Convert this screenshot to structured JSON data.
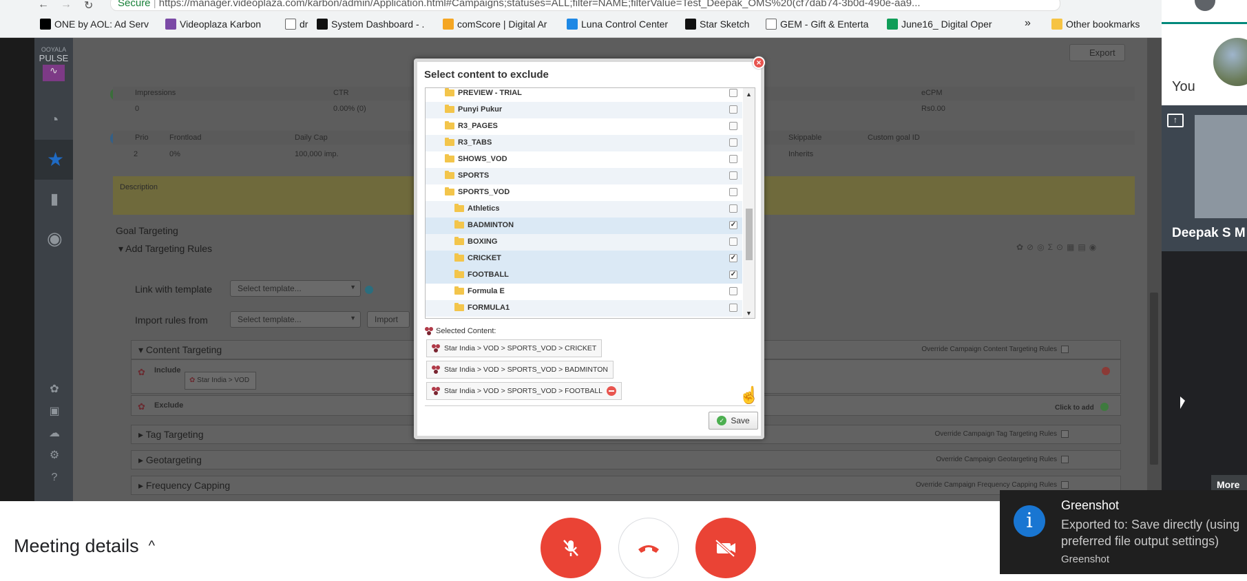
{
  "browser": {
    "secure_label": "Secure",
    "url": "https://manager.videoplaza.com/karbon/admin/Application.html#Campaigns;statuses=ALL;filter=NAME;filterValue=Test_Deepak_OMS%20(cf7dab74-3b0d-490e-aa9...",
    "bookmarks": [
      {
        "label": "ONE by AOL: Ad Serv",
        "icon": "aol-icon",
        "color": "#000000"
      },
      {
        "label": "Videoplaza Karbon",
        "icon": "videoplaza-icon",
        "color": "#7b4aa6"
      },
      {
        "label": "dr",
        "icon": "page-icon",
        "color": "#ffffff"
      },
      {
        "label": "System Dashboard - .",
        "icon": "jira-icon",
        "color": "#111111"
      },
      {
        "label": "comScore | Digital Ar",
        "icon": "comscore-icon",
        "color": "#f5a623"
      },
      {
        "label": "Luna Control Center",
        "icon": "akamai-icon",
        "color": "#1e88e5"
      },
      {
        "label": "Star Sketch",
        "icon": "star-icon",
        "color": "#111111"
      },
      {
        "label": "GEM - Gift & Enterta",
        "icon": "page-icon",
        "color": "#ffffff"
      },
      {
        "label": "June16_ Digital Oper",
        "icon": "sheets-icon",
        "color": "#0f9d58"
      }
    ],
    "overflow_label": "»",
    "other_bookmarks": "Other bookmarks"
  },
  "app": {
    "logo_top": "OOYALA",
    "logo_bottom": "PULSE",
    "export_label": "Export",
    "stats_headers": {
      "impressions": "Impressions",
      "ctr": "CTR",
      "ecpm": "eCPM"
    },
    "stats_values": {
      "impressions": "0",
      "ctr": "0.00% (0)",
      "ecpm": "Rs0.00"
    },
    "goal_headers": {
      "prio": "Prio",
      "frontload": "Frontload",
      "daily_cap": "Daily Cap",
      "skippable": "Skippable",
      "custom_goal": "Custom goal ID"
    },
    "goal_values": {
      "prio": "2",
      "frontload": "0%",
      "daily_cap": "100,000 imp.",
      "skippable": "Inherits"
    },
    "description_label": "Description",
    "goal_targeting": "Goal Targeting",
    "add_rules": "Add Targeting Rules",
    "link_template_label": "Link with template",
    "import_rules_label": "Import rules from",
    "select_template_placeholder": "Select template...",
    "import_button": "Import",
    "content_targeting": "Content Targeting",
    "override_content": "Override Campaign Content Targeting Rules",
    "include_label": "Include",
    "include_chip": "Star India > VOD",
    "exclude_label": "Exclude",
    "click_to_add": "Click to add",
    "tag_targeting": "Tag Targeting",
    "override_tag": "Override Campaign Tag Targeting Rules",
    "geotargeting": "Geotargeting",
    "override_geo": "Override Campaign Geotargeting Rules",
    "frequency_capping": "Frequency Capping",
    "override_freq": "Override Campaign Frequency Capping Rules"
  },
  "modal": {
    "title": "Select content to exclude",
    "close_glyph": "×",
    "tree": [
      {
        "name": "PREVIEW - TRIAL",
        "indent": 1,
        "checked": false
      },
      {
        "name": "Punyi Pukur",
        "indent": 1,
        "checked": false
      },
      {
        "name": "R3_PAGES",
        "indent": 1,
        "checked": false
      },
      {
        "name": "R3_TABS",
        "indent": 1,
        "checked": false
      },
      {
        "name": "SHOWS_VOD",
        "indent": 1,
        "checked": false
      },
      {
        "name": "SPORTS",
        "indent": 1,
        "checked": false
      },
      {
        "name": "SPORTS_VOD",
        "indent": 1,
        "checked": false
      },
      {
        "name": "Athletics",
        "indent": 2,
        "checked": false
      },
      {
        "name": "BADMINTON",
        "indent": 2,
        "checked": true
      },
      {
        "name": "BOXING",
        "indent": 2,
        "checked": false
      },
      {
        "name": "CRICKET",
        "indent": 2,
        "checked": true
      },
      {
        "name": "FOOTBALL",
        "indent": 2,
        "checked": true
      },
      {
        "name": "Formula E",
        "indent": 2,
        "checked": false
      },
      {
        "name": "FORMULA1",
        "indent": 2,
        "checked": false
      }
    ],
    "selected_label": "Selected Content:",
    "selected_items": [
      "Star India > VOD > SPORTS_VOD > CRICKET",
      "Star India > VOD > SPORTS_VOD > BADMINTON",
      "Star India > VOD > SPORTS_VOD > FOOTBALL"
    ],
    "save_label": "Save"
  },
  "meet": {
    "you_label": "You",
    "presenter_name": "Deepak S M",
    "more_label": "More",
    "meeting_details": "Meeting details",
    "chevron": "^"
  },
  "toast": {
    "title": "Greenshot",
    "message": "Exported to: Save directly (using preferred file output settings)",
    "app": "Greenshot",
    "icon_glyph": "i"
  }
}
